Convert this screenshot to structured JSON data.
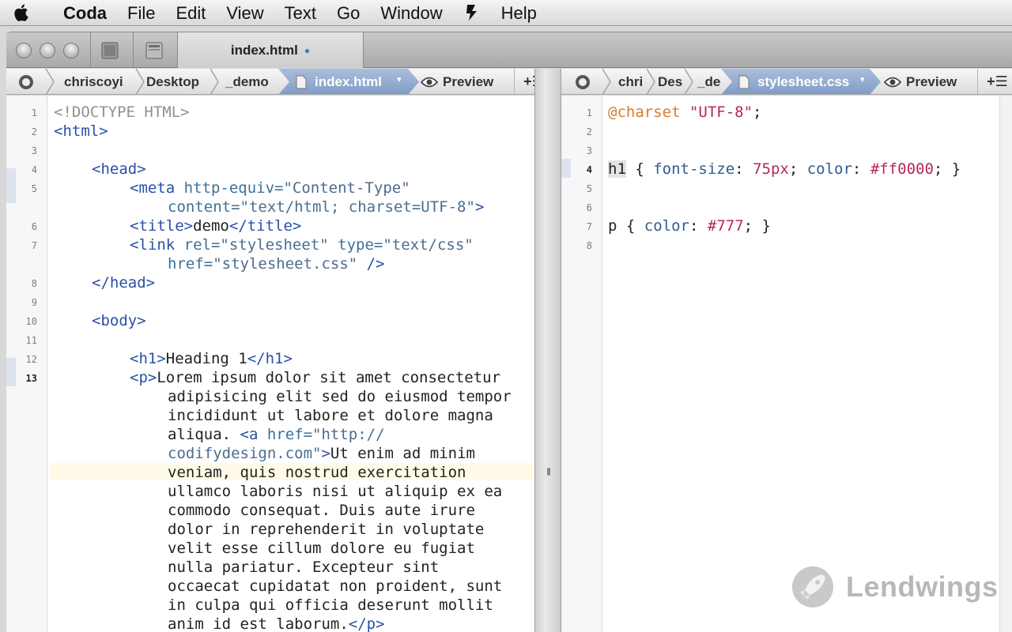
{
  "menubar": {
    "app_name": "Coda",
    "items": [
      "File",
      "Edit",
      "View",
      "Text",
      "Go",
      "Window",
      "Help"
    ]
  },
  "toolbar": {
    "document_tab": "index.html"
  },
  "left_path": {
    "segments": [
      "chriscoyi",
      "Desktop",
      "_demo"
    ],
    "active": "index.html",
    "preview": "Preview"
  },
  "right_path": {
    "segments": [
      "chri",
      "Des",
      "_de"
    ],
    "active": "stylesheet.css",
    "preview": "Preview"
  },
  "left_editor": {
    "line_numbers": [
      "1",
      "2",
      "3",
      "4",
      "5",
      "",
      "6",
      "7",
      "",
      "8",
      "9",
      "10",
      "11",
      "12",
      "13"
    ],
    "current_line": "13"
  },
  "right_editor": {
    "line_numbers": [
      "1",
      "2",
      "3",
      "4",
      "5",
      "6",
      "7",
      "8"
    ],
    "current_line": "4"
  },
  "html_code": {
    "doctype": "<!DOCTYPE HTML>",
    "html_open": "<html>",
    "head_open": "<head>",
    "meta_open": "<meta ",
    "meta_attr1": "http-equiv=",
    "meta_val1": "\"Content-Type\"",
    "meta_attr2": "content=",
    "meta_val2": "\"text/html; charset=UTF-8\"",
    "meta_close": ">",
    "title_open": "<title>",
    "title_text": "demo",
    "title_close": "</title>",
    "link_open": "<link ",
    "link_attr1": "rel=",
    "link_val1": "\"stylesheet\"",
    "link_attr2": "type=",
    "link_val2": "\"text/css\"",
    "link_attr3": "href=",
    "link_val3": "\"stylesheet.css\"",
    "link_close": " />",
    "head_close": "</head>",
    "body_open": "<body>",
    "h1_open": "<h1>",
    "h1_text": "Heading 1",
    "h1_close": "</h1>",
    "p_open": "<p>",
    "p_line1": "Lorem ipsum dolor sit amet consectetur",
    "p_line2": "adipisicing elit sed do eiusmod tempor",
    "p_line3": "incididunt ut labore et dolore magna",
    "p_line4": "aliqua. ",
    "a_open": "<a ",
    "a_attr": "href=",
    "a_val1": "\"http://",
    "a_val2": "codifydesign.com\"",
    "a_close": ">",
    "p_line5": "Ut enim ad minim",
    "p_line6": "veniam, quis nostrud exercitation",
    "p_line7": "ullamco laboris nisi ut aliquip ex ea",
    "p_line8": "commodo consequat. Duis aute irure",
    "p_line9": "dolor in reprehenderit in voluptate",
    "p_line10": "velit esse cillum dolore eu fugiat",
    "p_line11": "nulla pariatur. Excepteur sint",
    "p_line12": "occaecat cupidatat non proident, sunt",
    "p_line13": "in culpa qui officia deserunt mollit",
    "p_line14": "anim id est laborum.",
    "p_close": "</p>"
  },
  "css_code": {
    "charset_kw": "@charset",
    "charset_val": "\"UTF-8\"",
    "charset_end": ";",
    "h1_sel": "h1",
    "h1_open": " { ",
    "h1_prop1": "font-size",
    "h1_colon1": ": ",
    "h1_val1": "75px",
    "h1_semi1": "; ",
    "h1_prop2": "color",
    "h1_colon2": ": ",
    "h1_val2": "#ff0000",
    "h1_end": "; }",
    "p_sel": "p",
    "p_open": " { ",
    "p_prop": "color",
    "p_colon": ": ",
    "p_val": "#777",
    "p_end": "; }"
  },
  "watermark": {
    "text": "Lendwings"
  }
}
